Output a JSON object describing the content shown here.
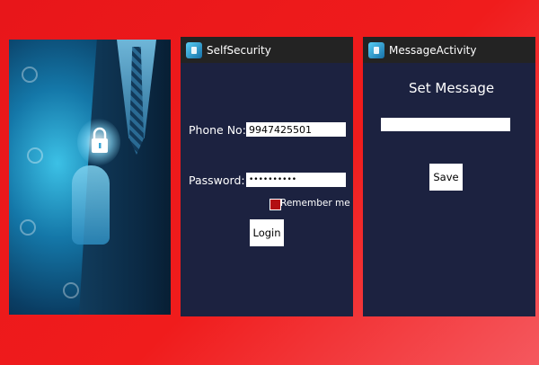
{
  "photo": {
    "alt": ""
  },
  "screen1": {
    "title": "SelfSecurity",
    "phone_label": "Phone No:",
    "phone_value": "9947425501",
    "password_label": "Password:",
    "password_value": "••••••••••",
    "remember_label": "Remember me",
    "login_label": "Login"
  },
  "screen2": {
    "title": "MessageActivity",
    "heading": "Set Message",
    "message_value": "",
    "save_label": "Save"
  },
  "colors": {
    "background_red": "#e8161a",
    "screen_bg": "#1c2240",
    "actionbar_bg": "#232323",
    "checkbox_red": "#b30f12"
  }
}
